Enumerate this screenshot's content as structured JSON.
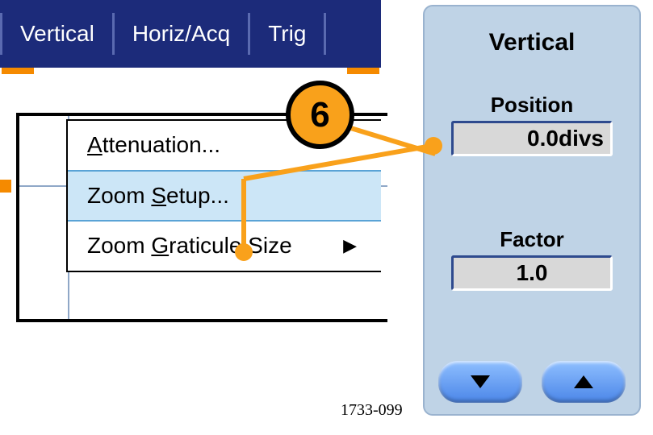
{
  "menu": {
    "items": [
      "Vertical",
      "Horiz/Acq",
      "Trig"
    ]
  },
  "dropdown": {
    "items": [
      {
        "pre": "",
        "hot": "A",
        "post": "ttenuation..."
      },
      {
        "pre": "Zoom ",
        "hot": "S",
        "post": "etup..."
      },
      {
        "pre": "Zoom ",
        "hot": "G",
        "post": "raticule Size"
      }
    ]
  },
  "panel": {
    "title": "Vertical",
    "position_label": "Position",
    "position_value": "0.0divs",
    "factor_label": "Factor",
    "factor_value": "1.0"
  },
  "callout": {
    "num": "6"
  },
  "ref": "1733-099"
}
